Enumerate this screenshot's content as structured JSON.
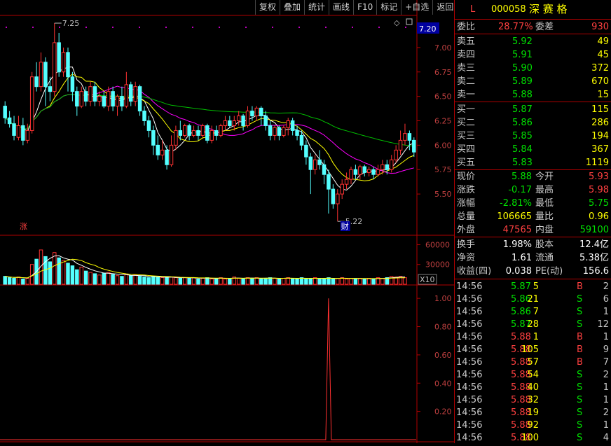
{
  "toolbar": {
    "buttons": [
      "复权",
      "叠加",
      "统计",
      "画线",
      "F10",
      "标记",
      "+自选",
      "返回"
    ]
  },
  "stock": {
    "flag": "L",
    "code": "000058",
    "name": "深 赛 格"
  },
  "order_ratio": {
    "label1": "委比",
    "value1": "28.77%",
    "label2": "委差",
    "value2": "930"
  },
  "asks": [
    {
      "label": "卖五",
      "price": "5.92",
      "vol": "49"
    },
    {
      "label": "卖四",
      "price": "5.91",
      "vol": "45"
    },
    {
      "label": "卖三",
      "price": "5.90",
      "vol": "372"
    },
    {
      "label": "卖二",
      "price": "5.89",
      "vol": "670"
    },
    {
      "label": "卖一",
      "price": "5.88",
      "vol": "15"
    }
  ],
  "bids": [
    {
      "label": "买一",
      "price": "5.87",
      "vol": "115"
    },
    {
      "label": "买二",
      "price": "5.86",
      "vol": "286"
    },
    {
      "label": "买三",
      "price": "5.85",
      "vol": "194"
    },
    {
      "label": "买四",
      "price": "5.84",
      "vol": "367"
    },
    {
      "label": "买五",
      "price": "5.83",
      "vol": "1119"
    }
  ],
  "quote": [
    {
      "l1": "现价",
      "v1": "5.88",
      "l2": "今开",
      "v2": "5.93",
      "c1": "g",
      "c2": "r"
    },
    {
      "l1": "涨跌",
      "v1": "-0.17",
      "l2": "最高",
      "v2": "5.98",
      "c1": "g",
      "c2": "r"
    },
    {
      "l1": "涨幅",
      "v1": "-2.81%",
      "l2": "最低",
      "v2": "5.75",
      "c1": "g",
      "c2": "g"
    },
    {
      "l1": "总量",
      "v1": "106665",
      "l2": "量比",
      "v2": "0.96",
      "c1": "y",
      "c2": "y"
    },
    {
      "l1": "外盘",
      "v1": "47565",
      "l2": "内盘",
      "v2": "59100",
      "c1": "r",
      "c2": "g"
    }
  ],
  "stats": [
    {
      "l1": "换手",
      "v1": "1.98%",
      "l2": "股本",
      "v2": "12.4亿"
    },
    {
      "l1": "净资",
      "v1": "1.61",
      "l2": "流通",
      "v2": "5.38亿"
    },
    {
      "l1": "收益(四)",
      "v1": "0.038",
      "l2": "PE(动)",
      "v2": "156.6"
    }
  ],
  "ticks": [
    {
      "t": "14:56",
      "p": "5.87",
      "v": "5",
      "s": "B",
      "n": "2"
    },
    {
      "t": "14:56",
      "p": "5.86",
      "v": "21",
      "s": "S",
      "n": "6"
    },
    {
      "t": "14:56",
      "p": "5.86",
      "v": "7",
      "s": "S",
      "n": "1"
    },
    {
      "t": "14:56",
      "p": "5.87",
      "v": "28",
      "s": "S",
      "n": "12"
    },
    {
      "t": "14:56",
      "p": "5.88",
      "v": "1",
      "s": "B",
      "n": "1"
    },
    {
      "t": "14:56",
      "p": "5.88",
      "v": "105",
      "s": "B",
      "n": "9"
    },
    {
      "t": "14:56",
      "p": "5.88",
      "v": "57",
      "s": "B",
      "n": "7"
    },
    {
      "t": "14:56",
      "p": "5.88",
      "v": "54",
      "s": "S",
      "n": "2"
    },
    {
      "t": "14:56",
      "p": "5.88",
      "v": "40",
      "s": "S",
      "n": "1"
    },
    {
      "t": "14:56",
      "p": "5.88",
      "v": "32",
      "s": "S",
      "n": "1"
    },
    {
      "t": "14:56",
      "p": "5.88",
      "v": "19",
      "s": "S",
      "n": "2"
    },
    {
      "t": "14:56",
      "p": "5.88",
      "v": "92",
      "s": "S",
      "n": "1"
    },
    {
      "t": "14:56",
      "p": "5.88",
      "v": "100",
      "s": "S",
      "n": "4"
    }
  ],
  "chart_data": [
    {
      "type": "candlestick",
      "title": "",
      "y_ticks": [
        "7.00",
        "6.75",
        "6.50",
        "6.25",
        "6.00",
        "5.75",
        "5.50"
      ],
      "current_price_label": "7.20",
      "high_annotation": "7.25",
      "low_annotation": "5.22",
      "markers": [
        "涨",
        "财"
      ],
      "ylim": [
        5.3,
        7.2
      ],
      "candles": [
        [
          6.4,
          6.28,
          6.45,
          6.22
        ],
        [
          6.28,
          6.22,
          6.35,
          6.18
        ],
        [
          6.22,
          6.1,
          6.3,
          6.05
        ],
        [
          6.08,
          6.2,
          6.3,
          6.05
        ],
        [
          6.2,
          6.05,
          6.28,
          6.0
        ],
        [
          6.05,
          6.15,
          6.22,
          6.02
        ],
        [
          6.15,
          6.7,
          6.75,
          6.12
        ],
        [
          6.7,
          6.6,
          6.85,
          6.55
        ],
        [
          6.6,
          6.85,
          6.95,
          6.55
        ],
        [
          6.85,
          6.6,
          6.9,
          6.4
        ],
        [
          6.6,
          6.55,
          6.7,
          6.45
        ],
        [
          6.55,
          7.05,
          7.25,
          6.5
        ],
        [
          7.05,
          6.75,
          7.15,
          6.7
        ],
        [
          6.75,
          6.95,
          7.0,
          6.7
        ],
        [
          6.95,
          6.7,
          7.0,
          6.55
        ],
        [
          6.7,
          6.55,
          6.75,
          6.45
        ],
        [
          6.55,
          6.4,
          6.6,
          6.3
        ],
        [
          6.4,
          6.55,
          6.6,
          6.38
        ],
        [
          6.55,
          6.45,
          6.6,
          6.4
        ],
        [
          6.45,
          6.6,
          6.65,
          6.4
        ],
        [
          6.6,
          6.45,
          6.65,
          6.4
        ],
        [
          6.45,
          6.5,
          6.55,
          6.4
        ],
        [
          6.5,
          6.4,
          6.55,
          6.38
        ],
        [
          6.4,
          6.55,
          6.6,
          6.35
        ],
        [
          6.55,
          6.4,
          6.6,
          6.35
        ],
        [
          6.4,
          6.5,
          6.52,
          6.3
        ],
        [
          6.5,
          6.4,
          6.6,
          6.35
        ],
        [
          6.4,
          6.62,
          6.75,
          6.38
        ],
        [
          6.62,
          6.45,
          6.65,
          6.4
        ],
        [
          6.45,
          6.6,
          6.65,
          6.4
        ],
        [
          6.6,
          6.35,
          6.62,
          6.3
        ],
        [
          6.35,
          6.25,
          6.4,
          6.2
        ],
        [
          6.25,
          6.15,
          6.3,
          6.08
        ],
        [
          6.15,
          6.0,
          6.2,
          5.9
        ],
        [
          6.0,
          5.9,
          6.1,
          5.85
        ],
        [
          5.9,
          5.95,
          6.05,
          5.85
        ],
        [
          5.95,
          5.8,
          6.0,
          5.75
        ],
        [
          5.8,
          6.0,
          6.1,
          5.78
        ],
        [
          6.0,
          6.15,
          6.2,
          5.95
        ],
        [
          6.15,
          6.1,
          6.25,
          6.05
        ],
        [
          6.1,
          6.2,
          6.22,
          6.08
        ],
        [
          6.2,
          6.1,
          6.22,
          6.05
        ],
        [
          6.1,
          6.15,
          6.2,
          6.08
        ],
        [
          6.15,
          6.1,
          6.2,
          6.05
        ],
        [
          6.1,
          6.2,
          6.22,
          6.08
        ],
        [
          6.2,
          6.05,
          6.22,
          6.02
        ],
        [
          6.05,
          6.15,
          6.2,
          6.02
        ],
        [
          6.15,
          6.1,
          6.2,
          6.05
        ],
        [
          6.1,
          6.2,
          6.22,
          6.08
        ],
        [
          6.2,
          6.25,
          6.3,
          6.15
        ],
        [
          6.25,
          6.2,
          6.3,
          6.18
        ],
        [
          6.2,
          6.25,
          6.3,
          6.15
        ],
        [
          6.25,
          6.3,
          6.35,
          6.2
        ],
        [
          6.3,
          6.2,
          6.32,
          6.15
        ],
        [
          6.2,
          6.35,
          6.4,
          6.18
        ],
        [
          6.35,
          6.3,
          6.4,
          6.25
        ],
        [
          6.3,
          6.38,
          6.4,
          6.25
        ],
        [
          6.38,
          6.3,
          6.4,
          6.2
        ],
        [
          6.3,
          6.2,
          6.35,
          6.15
        ],
        [
          6.2,
          6.1,
          6.25,
          6.05
        ],
        [
          6.1,
          6.18,
          6.2,
          6.05
        ],
        [
          6.18,
          6.1,
          6.2,
          6.05
        ],
        [
          6.1,
          6.18,
          6.2,
          6.08
        ],
        [
          6.18,
          6.25,
          6.28,
          6.1
        ],
        [
          6.25,
          6.15,
          6.28,
          6.1
        ],
        [
          6.15,
          6.1,
          6.2,
          6.05
        ],
        [
          6.1,
          6.0,
          6.15,
          5.95
        ],
        [
          6.0,
          5.88,
          6.05,
          5.8
        ],
        [
          5.88,
          5.75,
          5.92,
          5.5
        ],
        [
          5.75,
          5.85,
          5.9,
          5.7
        ],
        [
          5.85,
          5.8,
          5.95,
          5.75
        ],
        [
          5.8,
          5.7,
          5.85,
          5.6
        ],
        [
          5.7,
          5.55,
          5.75,
          5.3
        ],
        [
          5.55,
          5.4,
          5.6,
          5.35
        ],
        [
          5.4,
          5.5,
          5.55,
          5.22
        ],
        [
          5.5,
          5.6,
          5.65,
          5.45
        ],
        [
          5.6,
          5.65,
          5.72,
          5.55
        ],
        [
          5.65,
          5.75,
          5.78,
          5.6
        ],
        [
          5.75,
          5.7,
          5.8,
          5.65
        ],
        [
          5.7,
          5.78,
          5.8,
          5.65
        ],
        [
          5.78,
          5.72,
          5.8,
          5.68
        ],
        [
          5.72,
          5.75,
          5.78,
          5.68
        ],
        [
          5.75,
          5.7,
          5.78,
          5.65
        ],
        [
          5.7,
          5.75,
          5.8,
          5.68
        ],
        [
          5.75,
          5.8,
          5.85,
          5.7
        ],
        [
          5.8,
          5.75,
          5.85,
          5.7
        ],
        [
          5.75,
          5.85,
          5.9,
          5.72
        ],
        [
          5.85,
          5.95,
          6.0,
          5.82
        ],
        [
          5.95,
          6.05,
          6.15,
          5.9
        ],
        [
          6.05,
          6.12,
          6.22,
          6.0
        ],
        [
          6.12,
          6.05,
          6.15,
          5.95
        ],
        [
          6.05,
          5.93,
          6.08,
          5.88
        ]
      ]
    },
    {
      "type": "bar",
      "title": "",
      "y_ticks": [
        "60000",
        "30000"
      ],
      "unit_label": "X10",
      "ylim": [
        0,
        70000
      ],
      "values": [
        12000,
        10000,
        9000,
        11000,
        8000,
        9000,
        30000,
        38000,
        52000,
        42000,
        34000,
        48000,
        40000,
        36000,
        32000,
        28000,
        22000,
        26000,
        20000,
        18000,
        16000,
        14000,
        17000,
        18000,
        15000,
        13000,
        12000,
        15000,
        13000,
        14000,
        12000,
        11000,
        10000,
        12000,
        11000,
        10000,
        10000,
        11000,
        10000,
        9000,
        10000,
        9000,
        10000,
        8000,
        9000,
        10000,
        8000,
        9000,
        10000,
        8000,
        9000,
        11000,
        9000,
        8000,
        10000,
        9000,
        10000,
        8000,
        9000,
        10000,
        9000,
        8000,
        9000,
        10000,
        9000,
        8000,
        10000,
        8000,
        9000,
        10000,
        8000,
        9000,
        10000,
        8000,
        9000,
        10000,
        8000,
        9000,
        8000,
        9000,
        8000,
        9000,
        8000,
        10000,
        9000,
        10000,
        12000,
        11000,
        12000,
        10000
      ]
    },
    {
      "type": "line",
      "title": "",
      "y_ticks": [
        "1.00",
        "0.80",
        "0.60",
        "0.40",
        "0.20"
      ],
      "ylim": [
        0,
        1.08
      ],
      "values_nonzero": [
        {
          "index": 72,
          "value": 1.0
        }
      ]
    }
  ]
}
